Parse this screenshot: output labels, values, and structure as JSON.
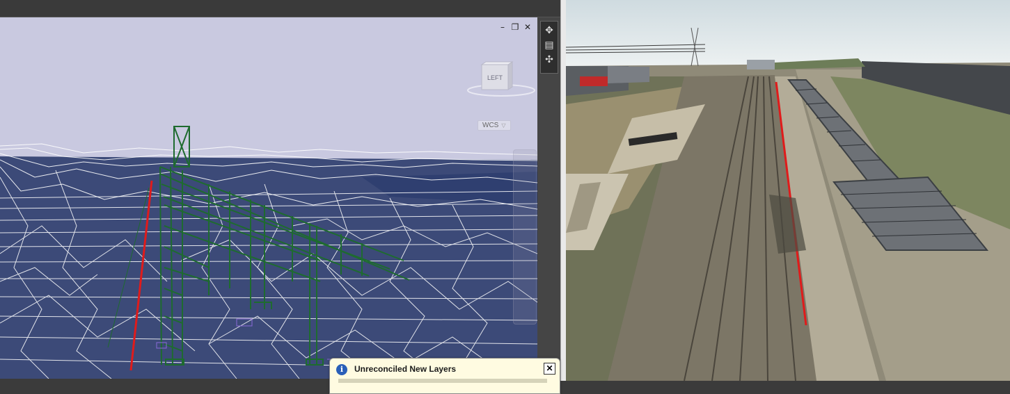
{
  "cad": {
    "viewcube_label": "LEFT",
    "ucs_label": "WCS",
    "window_controls": {
      "minimize": "–",
      "restore": "❐",
      "close": "✕"
    },
    "toolbar_icons": [
      "pan-icon",
      "properties-icon",
      "orbit-icon"
    ]
  },
  "notification": {
    "title": "Unreconciled New Layers",
    "icon": "info-icon",
    "close": "✕"
  },
  "colors": {
    "cad_background": "#c9c9e0",
    "terrain_fill": "#3c4a78",
    "wireframe": "#ffffff",
    "structure": "#1e6b2f",
    "alignment": "#e01b1b"
  }
}
